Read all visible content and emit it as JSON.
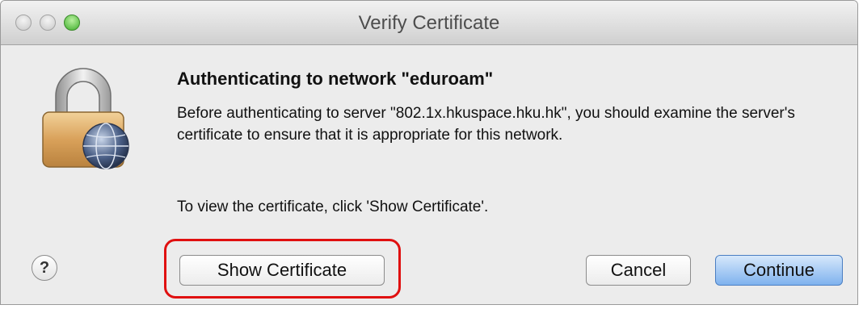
{
  "window": {
    "title": "Verify Certificate"
  },
  "dialog": {
    "heading": "Authenticating to network \"eduroam\"",
    "message": "Before authenticating to server \"802.1x.hkuspace.hku.hk\", you should examine the server's certificate to ensure that it is appropriate for this network.",
    "instruction": "To view the certificate, click 'Show Certificate'.",
    "icon": "lock-globe-icon"
  },
  "buttons": {
    "help_label": "?",
    "show_certificate_label": "Show Certificate",
    "cancel_label": "Cancel",
    "continue_label": "Continue"
  },
  "colors": {
    "highlight": "#e01010",
    "default_button": "#7fb2ee"
  }
}
